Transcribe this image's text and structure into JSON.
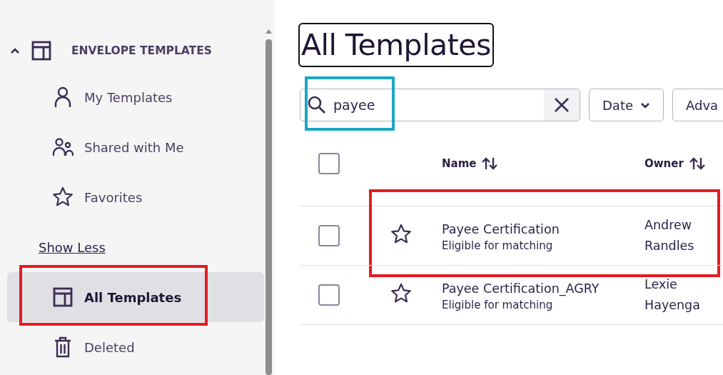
{
  "sidebar": {
    "section": {
      "title": "ENVELOPE TEMPLATES",
      "expanded": true
    },
    "items": [
      {
        "kind": "person",
        "label": "My Templates",
        "selected": false
      },
      {
        "kind": "people",
        "label": "Shared with Me",
        "selected": false
      },
      {
        "kind": "star",
        "label": "Favorites",
        "selected": false
      },
      {
        "kind": "link",
        "label": "Show Less",
        "selected": false
      },
      {
        "kind": "template",
        "label": "All Templates",
        "selected": true,
        "frame": {
          "color": "#e31b23"
        }
      },
      {
        "kind": "trash",
        "label": "Deleted",
        "selected": false
      }
    ]
  },
  "main": {
    "title": {
      "text": "All Templates",
      "focused": true
    },
    "search": {
      "value": "payee",
      "frame": {
        "color": "#1aa7c4"
      }
    },
    "filters": [
      {
        "label": "Date",
        "dropdown": true
      },
      {
        "label": "Adva",
        "dropdown": false
      }
    ],
    "table": {
      "columns": [
        {
          "label": "Name",
          "sortable": true
        },
        {
          "label": "Owner",
          "sortable": true
        }
      ],
      "select_all": {
        "checked": false
      },
      "rows": [
        {
          "checked": false,
          "favorite": false,
          "name": "Payee Certification",
          "subtitle": "Eligible for matching",
          "owner": "Andrew Randles",
          "frame": {
            "color": "#e31b23"
          }
        },
        {
          "checked": false,
          "favorite": false,
          "name": "Payee Certification_AGRY",
          "subtitle": "Eligible for matching",
          "owner": "Lexie Hayenga"
        }
      ]
    }
  }
}
